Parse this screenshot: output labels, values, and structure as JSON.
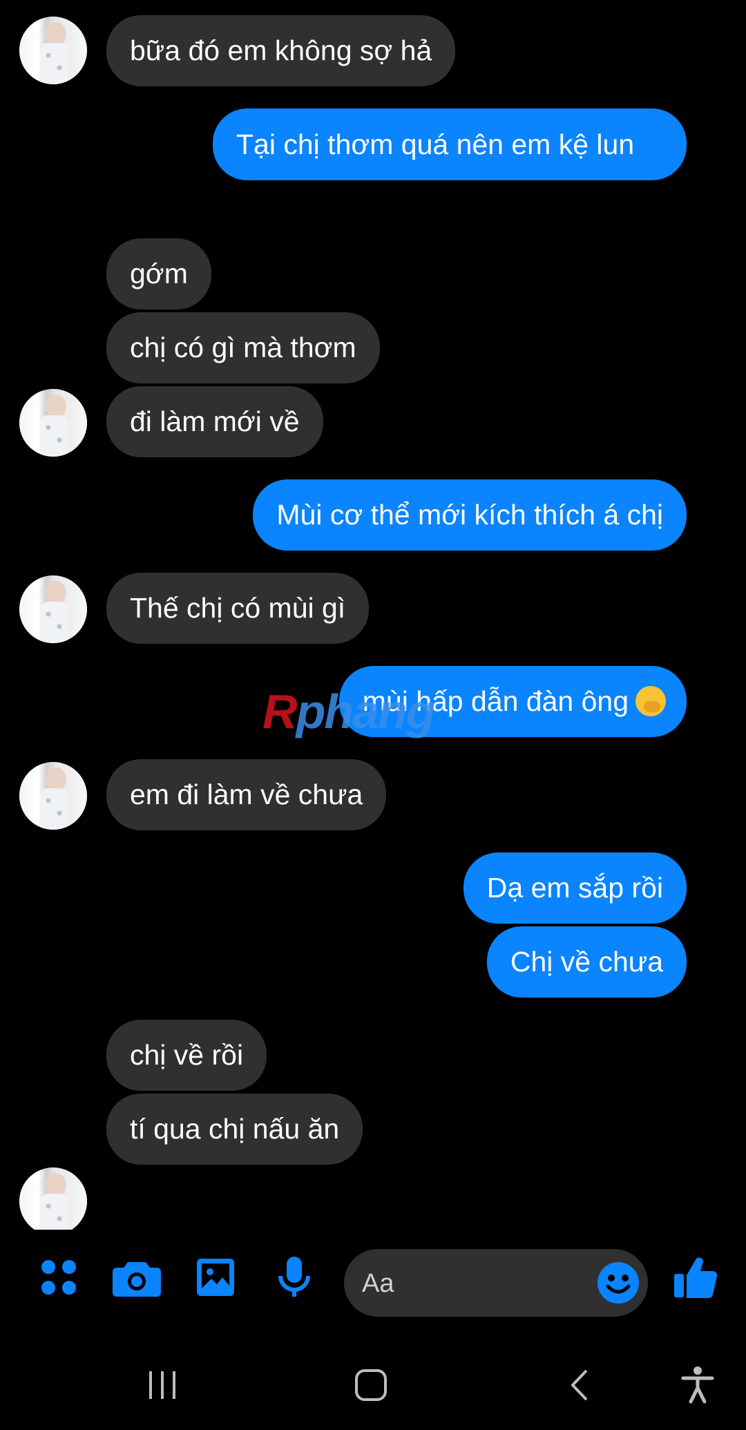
{
  "messages": [
    {
      "dir": "in",
      "text": "bữa đó em không sợ hả"
    },
    {
      "dir": "out",
      "text": "Tại chị thơm quá nên em kệ lun"
    },
    {
      "dir": "in",
      "text": "gớm"
    },
    {
      "dir": "in",
      "text": "chị có gì mà thơm"
    },
    {
      "dir": "in",
      "text": "đi làm mới về"
    },
    {
      "dir": "out",
      "text": "Mùi cơ thể mới kích thích á chị"
    },
    {
      "dir": "in",
      "text": "Thế chị có mùi gì"
    },
    {
      "dir": "out",
      "text": "mùi hấp dẫn đàn ông"
    },
    {
      "dir": "in",
      "text": "em đi làm về chưa"
    },
    {
      "dir": "out",
      "text": "Dạ em sắp rồi"
    },
    {
      "dir": "out",
      "text": "Chị về chưa"
    },
    {
      "dir": "in",
      "text": "chị về rồi"
    },
    {
      "dir": "in",
      "text": "tí qua chị nấu ăn"
    }
  ],
  "watermark": {
    "first": "R",
    "rest": "phang"
  },
  "composer": {
    "placeholder": "Aa",
    "icons": [
      "menu-icon",
      "camera-icon",
      "gallery-icon",
      "microphone-icon",
      "emoji-icon",
      "like-icon"
    ]
  },
  "navbar": {
    "icons": [
      "recents-icon",
      "home-icon",
      "back-icon",
      "accessibility-icon"
    ]
  },
  "colors": {
    "background": "#000000",
    "incoming_bubble": "#303030",
    "outgoing_bubble": "#0a84ff",
    "accent": "#0a84ff"
  }
}
